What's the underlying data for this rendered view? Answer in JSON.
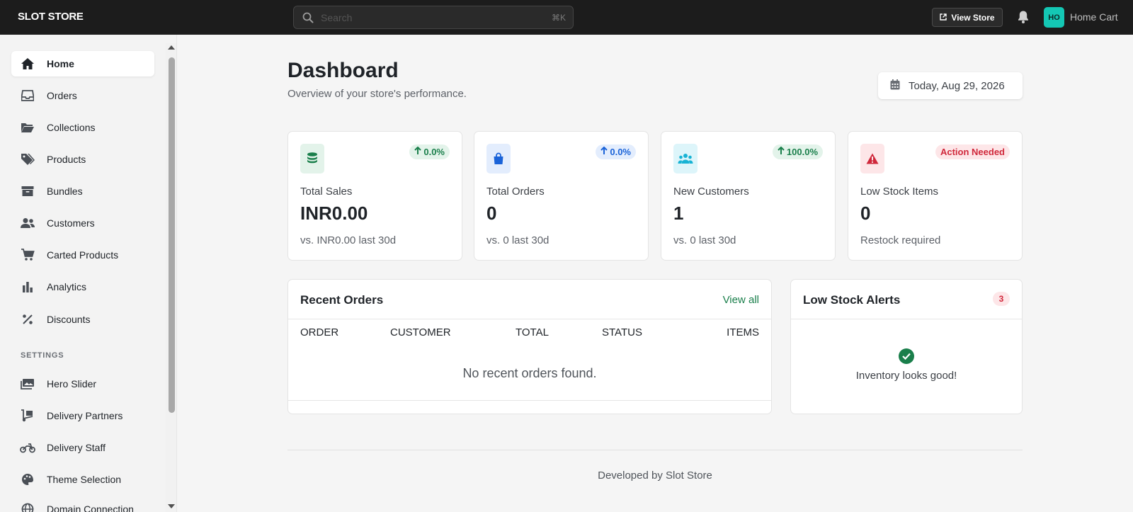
{
  "topbar": {
    "brand": "SLOT STORE",
    "search_placeholder": "Search",
    "search_shortcut": "⌘K",
    "view_store_label": "View Store",
    "avatar_initials": "HO",
    "store_name": "Home Cart"
  },
  "sidebar": {
    "items": [
      {
        "label": "Home",
        "icon": "home-icon"
      },
      {
        "label": "Orders",
        "icon": "inbox-icon"
      },
      {
        "label": "Collections",
        "icon": "folder-icon"
      },
      {
        "label": "Products",
        "icon": "tags-icon"
      },
      {
        "label": "Bundles",
        "icon": "archive-icon"
      },
      {
        "label": "Customers",
        "icon": "users-icon"
      },
      {
        "label": "Carted Products",
        "icon": "cart-icon"
      },
      {
        "label": "Analytics",
        "icon": "bar-chart-icon"
      },
      {
        "label": "Discounts",
        "icon": "percent-icon"
      }
    ],
    "settings_label": "SETTINGS",
    "settings_items": [
      {
        "label": "Hero Slider",
        "icon": "images-icon"
      },
      {
        "label": "Delivery Partners",
        "icon": "dolly-icon"
      },
      {
        "label": "Delivery Staff",
        "icon": "motorcycle-icon"
      },
      {
        "label": "Theme Selection",
        "icon": "palette-icon"
      },
      {
        "label": "Domain Connection",
        "icon": "globe-icon"
      }
    ]
  },
  "header": {
    "title": "Dashboard",
    "subtitle": "Overview of your store's performance.",
    "date_label": "Today, Aug 29, 2026"
  },
  "stats": [
    {
      "label": "Total Sales",
      "value": "INR0.00",
      "sub": "vs. INR0.00 last 30d",
      "badge": "0.0%",
      "icon": "coins-icon"
    },
    {
      "label": "Total Orders",
      "value": "0",
      "sub": "vs. 0 last 30d",
      "badge": "0.0%",
      "icon": "shopping-bag-icon"
    },
    {
      "label": "New Customers",
      "value": "1",
      "sub": "vs. 0 last 30d",
      "badge": "100.0%",
      "icon": "users-icon"
    },
    {
      "label": "Low Stock Items",
      "value": "0",
      "sub": "Restock required",
      "badge": "Action Needed",
      "icon": "warning-icon"
    }
  ],
  "recent_orders": {
    "title": "Recent Orders",
    "view_all": "View all",
    "columns": [
      "ORDER",
      "CUSTOMER",
      "TOTAL",
      "STATUS",
      "ITEMS"
    ],
    "empty_message": "No recent orders found."
  },
  "low_stock": {
    "title": "Low Stock Alerts",
    "count": "3",
    "message": "Inventory looks good!"
  },
  "footer": {
    "text": "Developed by Slot Store"
  },
  "colors": {
    "topbar": "#1c1c1c",
    "accent_green": "#1a7f4b",
    "accent_blue": "#1a63d8",
    "accent_cyan": "#17b3d4",
    "accent_red": "#d0283b",
    "avatar": "#14c7b4"
  }
}
